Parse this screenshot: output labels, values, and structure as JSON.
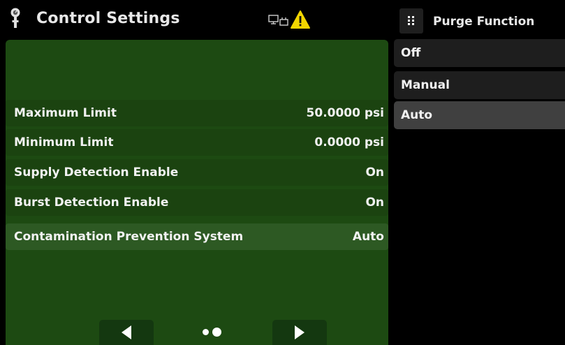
{
  "header": {
    "title": "Control Settings",
    "icons": [
      "pressure-gauge-icon",
      "remote-computer-icon",
      "warning-icon"
    ]
  },
  "settings": [
    {
      "label": "",
      "value": ""
    },
    {
      "label": "",
      "value": ""
    },
    {
      "label": "Maximum Limit",
      "value": "50.0000 psi"
    },
    {
      "label": "Minimum Limit",
      "value": "0.0000 psi"
    },
    {
      "label": "Supply Detection Enable",
      "value": "On"
    },
    {
      "label": "Burst Detection Enable",
      "value": "On"
    },
    {
      "label": "Contamination Prevention System",
      "value": "Auto",
      "selected": true
    }
  ],
  "pager": {
    "page_count": 2,
    "current_page": 2
  },
  "purge_panel": {
    "title": "Purge Function",
    "options": [
      {
        "label": "Off"
      },
      {
        "label": "Manual"
      },
      {
        "label": "Auto",
        "selected": true
      }
    ]
  },
  "colors": {
    "panel_green": "#1d4a12",
    "row_green": "#1b4310",
    "row_selected": "#2d5923",
    "warning_yellow": "#f2d600",
    "option_bg": "#1e1e1e",
    "option_selected": "#404040"
  }
}
